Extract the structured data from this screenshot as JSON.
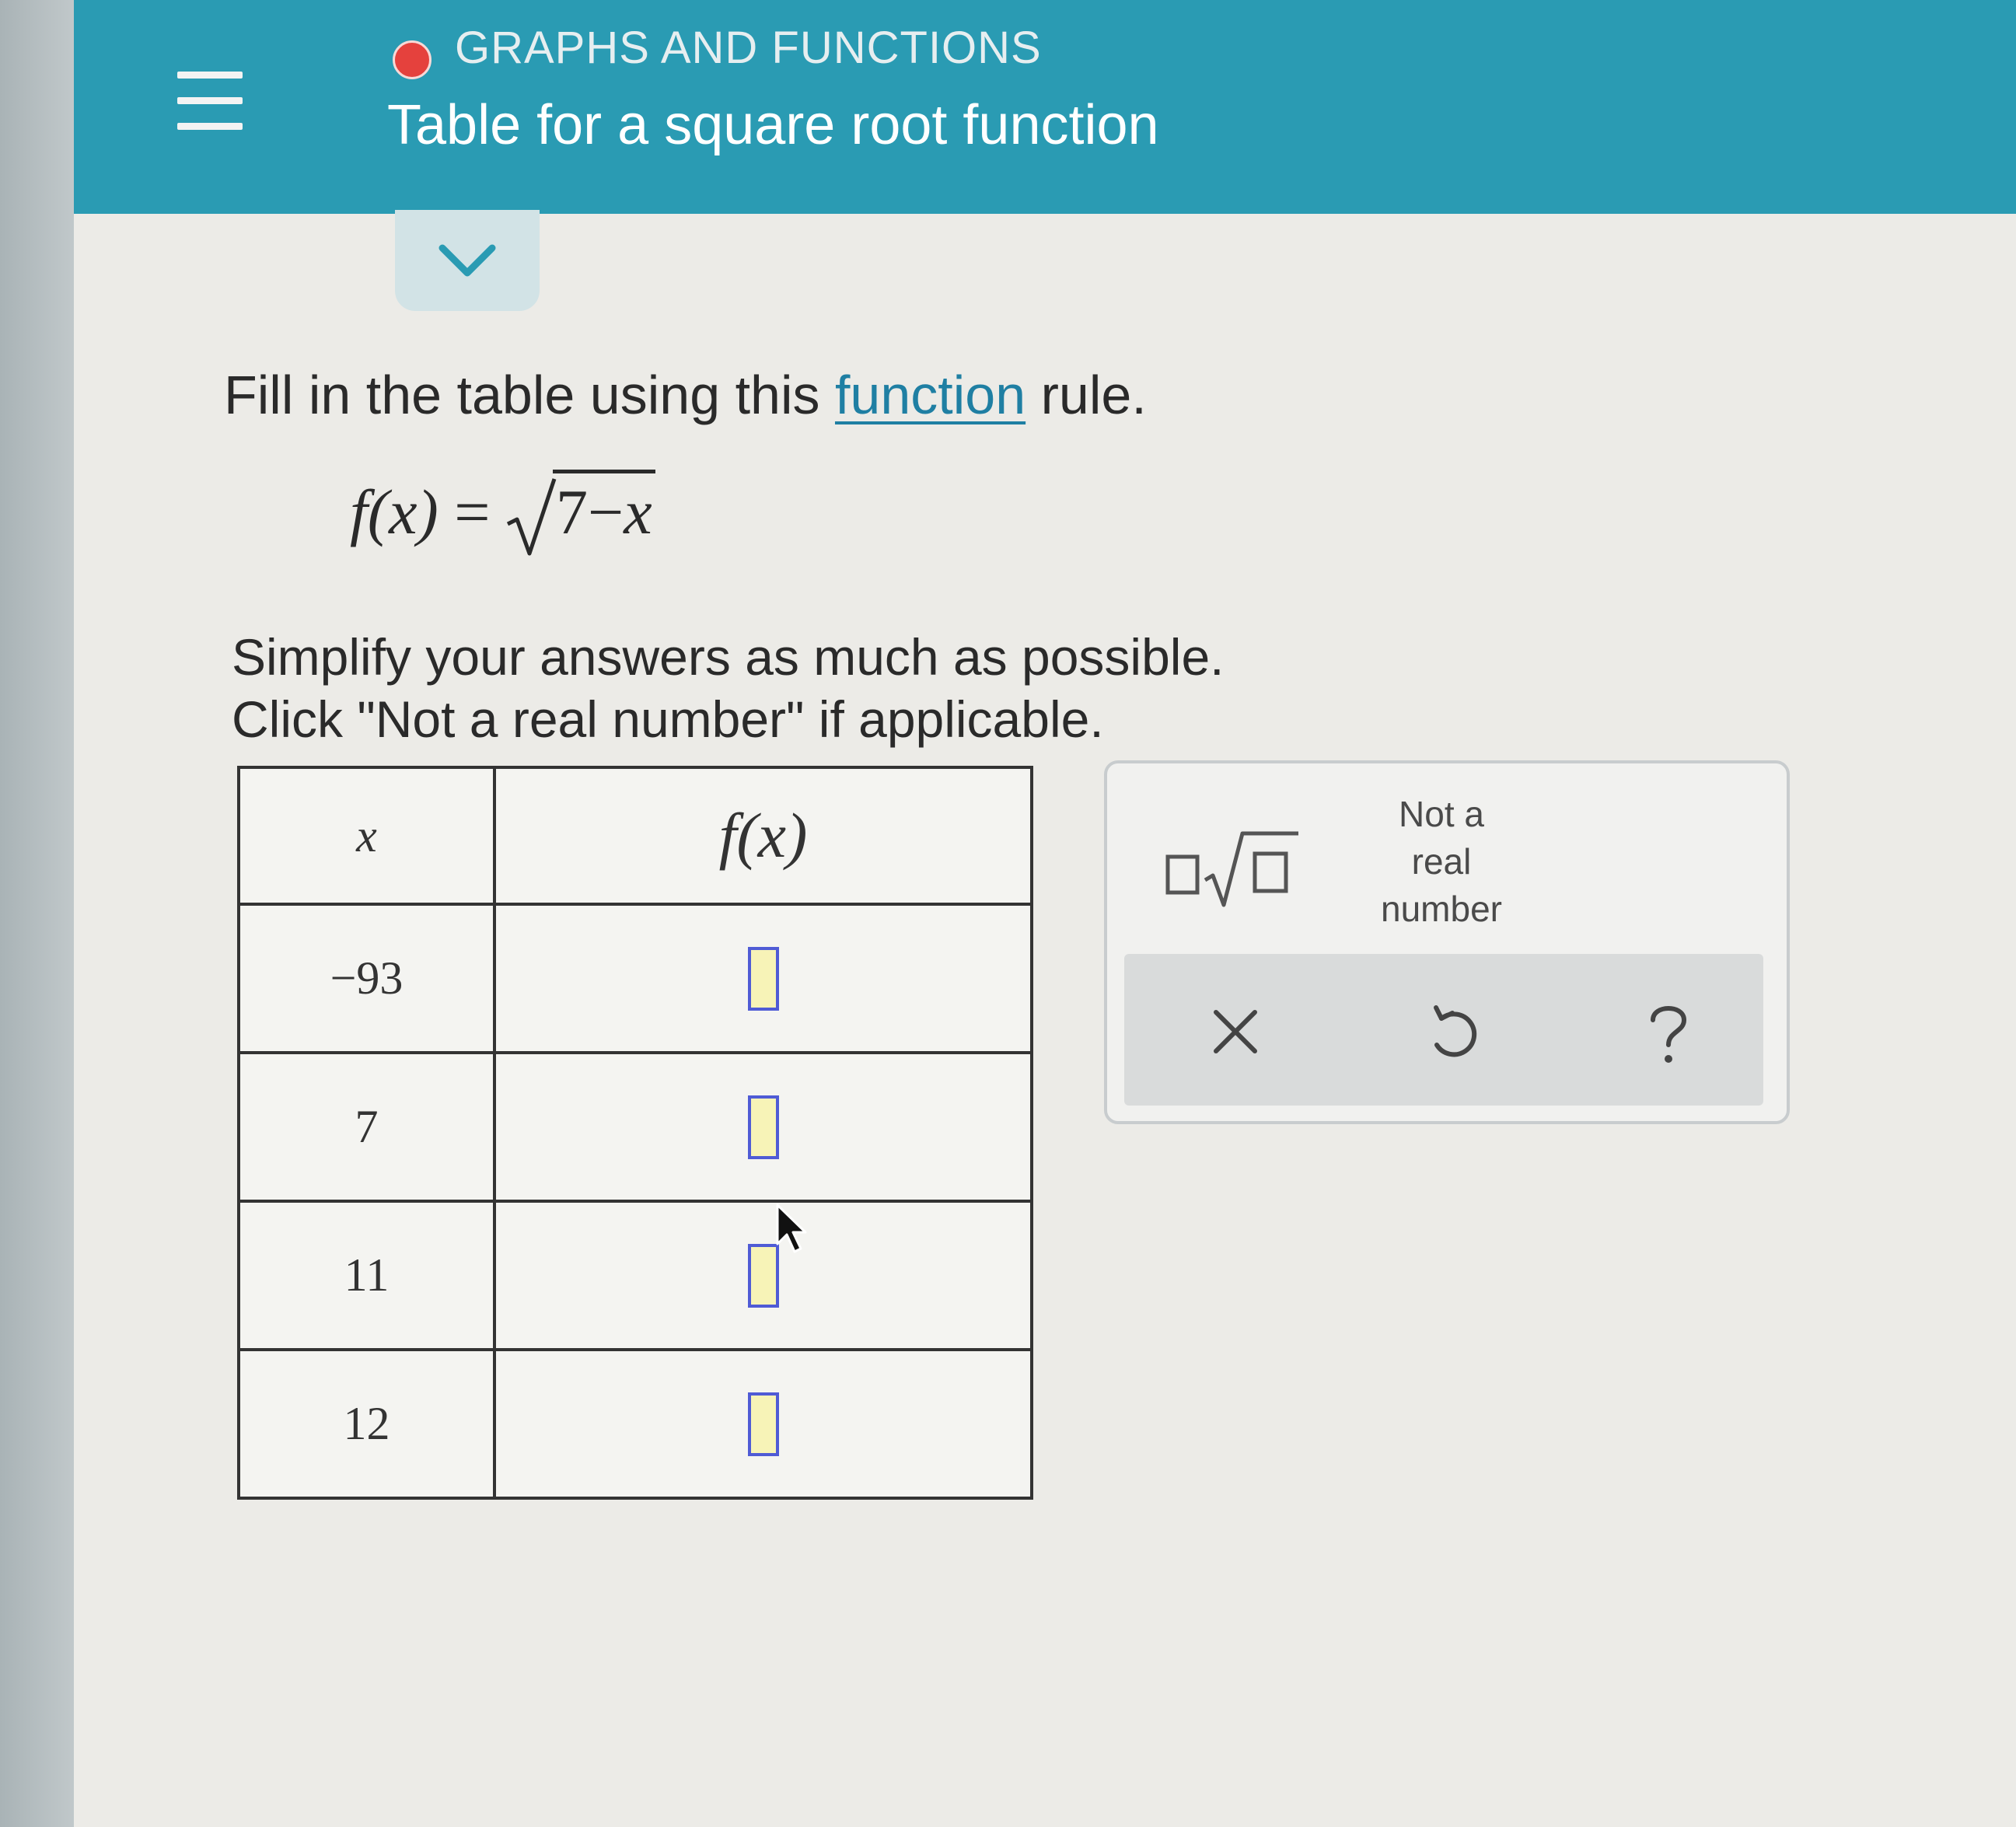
{
  "header": {
    "category": "GRAPHS AND FUNCTIONS",
    "topic": "Table for a square root function"
  },
  "colors": {
    "header_bg": "#2a9bb3",
    "status_dot": "#e5413d",
    "link": "#1f7fa3",
    "answer_box_border": "#4f5bd5",
    "answer_box_fill": "#f7f3b7"
  },
  "icons": {
    "menu": "hamburger-icon",
    "collapse": "chevron-down-icon",
    "sqrt": "square-root-template-icon",
    "clear": "close-icon",
    "undo": "undo-icon",
    "help": "question-mark-icon",
    "pointer": "mouse-cursor-icon"
  },
  "question": {
    "instruction_before": "Fill in the table using this ",
    "instruction_link": "function",
    "instruction_after": " rule.",
    "formula": {
      "lhs": "f(x)",
      "equals": "=",
      "radicand_const": "7",
      "radicand_op": "−",
      "radicand_var": "x"
    },
    "simplify_line1": "Simplify your answers as much as possible.",
    "simplify_line2": "Click \"Not a real number\" if applicable."
  },
  "table": {
    "headers": {
      "x": "x",
      "fx": "f(x)"
    },
    "rows": [
      {
        "x": "−93",
        "fx": ""
      },
      {
        "x": "7",
        "fx": ""
      },
      {
        "x": "11",
        "fx": ""
      },
      {
        "x": "12",
        "fx": ""
      }
    ]
  },
  "keypad": {
    "not_real_line1": "Not a",
    "not_real_line2": "real",
    "not_real_line3": "number"
  }
}
